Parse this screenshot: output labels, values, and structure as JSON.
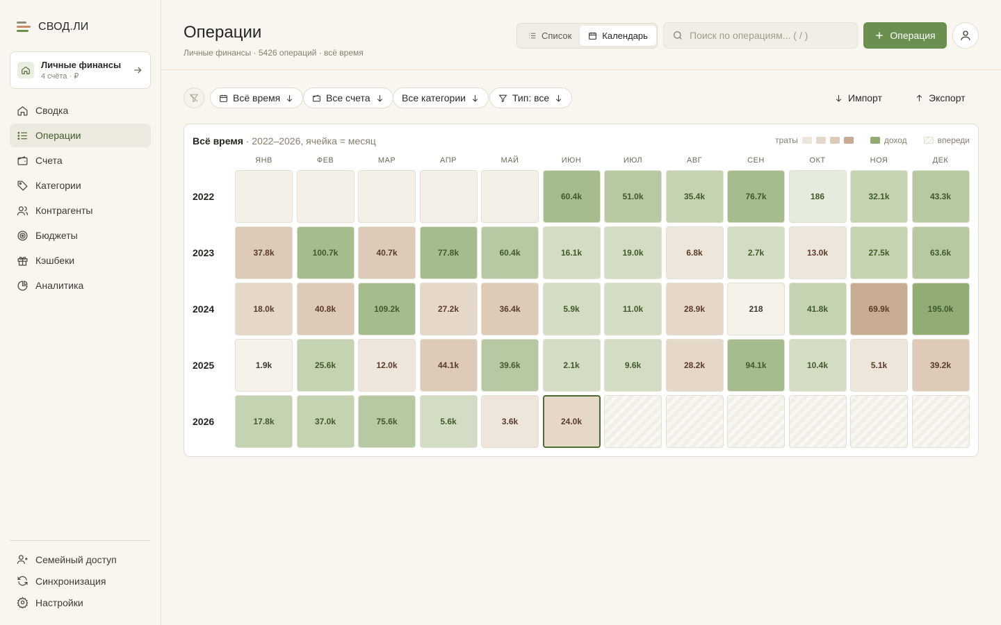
{
  "app": {
    "name": "СВОД.ЛИ",
    "workspace": {
      "title": "Личные финансы",
      "subtitle": "4 счёта · ₽"
    }
  },
  "sidebar": {
    "items": [
      {
        "label": "Сводка",
        "icon": "home-icon",
        "active": false
      },
      {
        "label": "Операции",
        "icon": "list-icon",
        "active": true
      },
      {
        "label": "Счета",
        "icon": "wallet-icon",
        "active": false
      },
      {
        "label": "Категории",
        "icon": "tag-icon",
        "active": false
      },
      {
        "label": "Контрагенты",
        "icon": "users-icon",
        "active": false
      },
      {
        "label": "Бюджеты",
        "icon": "target-icon",
        "active": false
      },
      {
        "label": "Кэшбеки",
        "icon": "gift-icon",
        "active": false
      },
      {
        "label": "Аналитика",
        "icon": "pie-chart-icon",
        "active": false
      }
    ],
    "bottom": [
      {
        "label": "Семейный доступ",
        "icon": "family-icon"
      },
      {
        "label": "Синхронизация",
        "icon": "sync-icon"
      },
      {
        "label": "Настройки",
        "icon": "gear-icon"
      }
    ]
  },
  "header": {
    "title": "Операции",
    "subtitle": "Личные финансы · 5426 операций · всё время",
    "view_list": "Список",
    "view_calendar": "Календарь",
    "search_placeholder": "Поиск по операциям... ( / )",
    "add_label": "Операция"
  },
  "filters": {
    "period": "Всё время",
    "accounts": "Все счета",
    "categories": "Все категории",
    "type": "Тип: все",
    "import": "Импорт",
    "export": "Экспорт"
  },
  "calendar": {
    "title": "Всё время",
    "subtitle": " · 2022–2026, ячейка = месяц",
    "legend": {
      "spend": "траты",
      "income": "доход",
      "ahead": "впереди"
    },
    "months": [
      "ЯНВ",
      "ФЕВ",
      "МАР",
      "АПР",
      "МАЙ",
      "ИЮН",
      "ИЮЛ",
      "АВГ",
      "СЕН",
      "ОКТ",
      "НОЯ",
      "ДЕК"
    ],
    "current": {
      "year": 2026,
      "month": 5
    },
    "colors": {
      "empty": "#f3f0e8",
      "income": [
        "#e6ecdd",
        "#d2ddc4",
        "#c4d3b2",
        "#b7c9a2",
        "#a5bc8d",
        "#92ac76"
      ],
      "spend": [
        "#f6f2ea",
        "#efe6db",
        "#e6d8c9",
        "#ddcab7",
        "#c7ab92"
      ],
      "income_text": "#3f5a2a",
      "spend_text": "#5a3a28"
    },
    "rows": [
      {
        "year": "2022",
        "cells": [
          {
            "v": "",
            "t": "empty",
            "l": 0
          },
          {
            "v": "",
            "t": "empty",
            "l": 0
          },
          {
            "v": "",
            "t": "empty",
            "l": 0
          },
          {
            "v": "",
            "t": "empty",
            "l": 0
          },
          {
            "v": "",
            "t": "empty",
            "l": 0
          },
          {
            "v": "60.4k",
            "t": "income",
            "l": 4
          },
          {
            "v": "51.0k",
            "t": "income",
            "l": 3
          },
          {
            "v": "35.4k",
            "t": "income",
            "l": 2
          },
          {
            "v": "76.7k",
            "t": "income",
            "l": 4
          },
          {
            "v": "186",
            "t": "income",
            "l": 0
          },
          {
            "v": "32.1k",
            "t": "income",
            "l": 2
          },
          {
            "v": "43.3k",
            "t": "income",
            "l": 3
          }
        ]
      },
      {
        "year": "2023",
        "cells": [
          {
            "v": "37.8k",
            "t": "spend",
            "l": 3
          },
          {
            "v": "100.7k",
            "t": "income",
            "l": 4
          },
          {
            "v": "40.7k",
            "t": "spend",
            "l": 3
          },
          {
            "v": "77.8k",
            "t": "income",
            "l": 4
          },
          {
            "v": "60.4k",
            "t": "income",
            "l": 3
          },
          {
            "v": "16.1k",
            "t": "income",
            "l": 1
          },
          {
            "v": "19.0k",
            "t": "income",
            "l": 1
          },
          {
            "v": "6.8k",
            "t": "spend",
            "l": 1
          },
          {
            "v": "2.7k",
            "t": "income",
            "l": 1
          },
          {
            "v": "13.0k",
            "t": "spend",
            "l": 1
          },
          {
            "v": "27.5k",
            "t": "income",
            "l": 2
          },
          {
            "v": "63.6k",
            "t": "income",
            "l": 3
          }
        ]
      },
      {
        "year": "2024",
        "cells": [
          {
            "v": "18.0k",
            "t": "spend",
            "l": 2
          },
          {
            "v": "40.8k",
            "t": "spend",
            "l": 3
          },
          {
            "v": "109.2k",
            "t": "income",
            "l": 4
          },
          {
            "v": "27.2k",
            "t": "spend",
            "l": 2
          },
          {
            "v": "36.4k",
            "t": "spend",
            "l": 3
          },
          {
            "v": "5.9k",
            "t": "income",
            "l": 1
          },
          {
            "v": "11.0k",
            "t": "income",
            "l": 1
          },
          {
            "v": "28.9k",
            "t": "spend",
            "l": 2
          },
          {
            "v": "218",
            "t": "spend",
            "l": 0
          },
          {
            "v": "41.8k",
            "t": "income",
            "l": 2
          },
          {
            "v": "69.9k",
            "t": "spend",
            "l": 4
          },
          {
            "v": "195.0k",
            "t": "income",
            "l": 5
          }
        ]
      },
      {
        "year": "2025",
        "cells": [
          {
            "v": "1.9k",
            "t": "spend",
            "l": 0
          },
          {
            "v": "25.6k",
            "t": "income",
            "l": 2
          },
          {
            "v": "12.0k",
            "t": "spend",
            "l": 1
          },
          {
            "v": "44.1k",
            "t": "spend",
            "l": 3
          },
          {
            "v": "39.6k",
            "t": "income",
            "l": 3
          },
          {
            "v": "2.1k",
            "t": "income",
            "l": 1
          },
          {
            "v": "9.6k",
            "t": "income",
            "l": 1
          },
          {
            "v": "28.2k",
            "t": "spend",
            "l": 2
          },
          {
            "v": "94.1k",
            "t": "income",
            "l": 4
          },
          {
            "v": "10.4k",
            "t": "income",
            "l": 1
          },
          {
            "v": "5.1k",
            "t": "spend",
            "l": 1
          },
          {
            "v": "39.2k",
            "t": "spend",
            "l": 3
          }
        ]
      },
      {
        "year": "2026",
        "cells": [
          {
            "v": "17.8k",
            "t": "income",
            "l": 2
          },
          {
            "v": "37.0k",
            "t": "income",
            "l": 2
          },
          {
            "v": "75.6k",
            "t": "income",
            "l": 3
          },
          {
            "v": "5.6k",
            "t": "income",
            "l": 1
          },
          {
            "v": "3.6k",
            "t": "spend",
            "l": 1
          },
          {
            "v": "24.0k",
            "t": "spend",
            "l": 2
          },
          {
            "v": "",
            "t": "future",
            "l": 0
          },
          {
            "v": "",
            "t": "future",
            "l": 0
          },
          {
            "v": "",
            "t": "future",
            "l": 0
          },
          {
            "v": "",
            "t": "future",
            "l": 0
          },
          {
            "v": "",
            "t": "future",
            "l": 0
          },
          {
            "v": "",
            "t": "future",
            "l": 0
          }
        ]
      }
    ]
  }
}
